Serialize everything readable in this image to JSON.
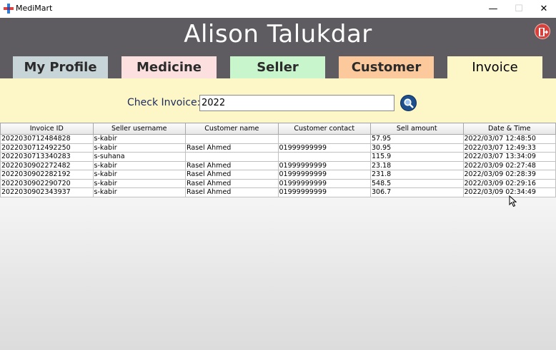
{
  "window": {
    "title": "MediMart",
    "minimize": "—",
    "maximize": "☐",
    "close": "✕"
  },
  "header": {
    "user_name": "Alison Talukdar",
    "logout_icon": "logout-icon"
  },
  "tabs": [
    {
      "label": "My Profile"
    },
    {
      "label": "Medicine"
    },
    {
      "label": "Seller"
    },
    {
      "label": "Customer"
    },
    {
      "label": "Invoice"
    }
  ],
  "search": {
    "label": "Check Invoice:",
    "value": "2022",
    "icon": "search-icon"
  },
  "table": {
    "columns": [
      "Invoice ID",
      "Seller username",
      "Customer name",
      "Customer contact",
      "Sell amount",
      "Date & Time"
    ],
    "rows": [
      [
        "2022030712484828",
        "s-kabir",
        "",
        "",
        "57.95",
        "2022/03/07 12:48:50"
      ],
      [
        "2022030712492250",
        "s-kabir",
        "Rasel Ahmed",
        "01999999999",
        "30.95",
        "2022/03/07 12:49:33"
      ],
      [
        "2022030713340283",
        "s-suhana",
        "",
        "",
        "115.9",
        "2022/03/07 13:34:09"
      ],
      [
        "2022030902272482",
        "s-kabir",
        "Rasel Ahmed",
        "01999999999",
        "23.18",
        "2022/03/09 02:27:48"
      ],
      [
        "2022030902282192",
        "s-kabir",
        "Rasel Ahmed",
        "01999999999",
        "231.8",
        "2022/03/09 02:28:39"
      ],
      [
        "2022030902290720",
        "s-kabir",
        "Rasel Ahmed",
        "01999999999",
        "548.5",
        "2022/03/09 02:29:16"
      ],
      [
        "2022030902343937",
        "s-kabir",
        "Rasel Ahmed",
        "01999999999",
        "306.7",
        "2022/03/09 02:34:49"
      ]
    ]
  },
  "colors": {
    "header_bg": "#5e5c61",
    "tab_profile": "#c7d5d8",
    "tab_medicine": "#fbe0df",
    "tab_seller": "#c9f5cd",
    "tab_customer": "#fbc99b",
    "tab_invoice": "#fdf6c7"
  }
}
